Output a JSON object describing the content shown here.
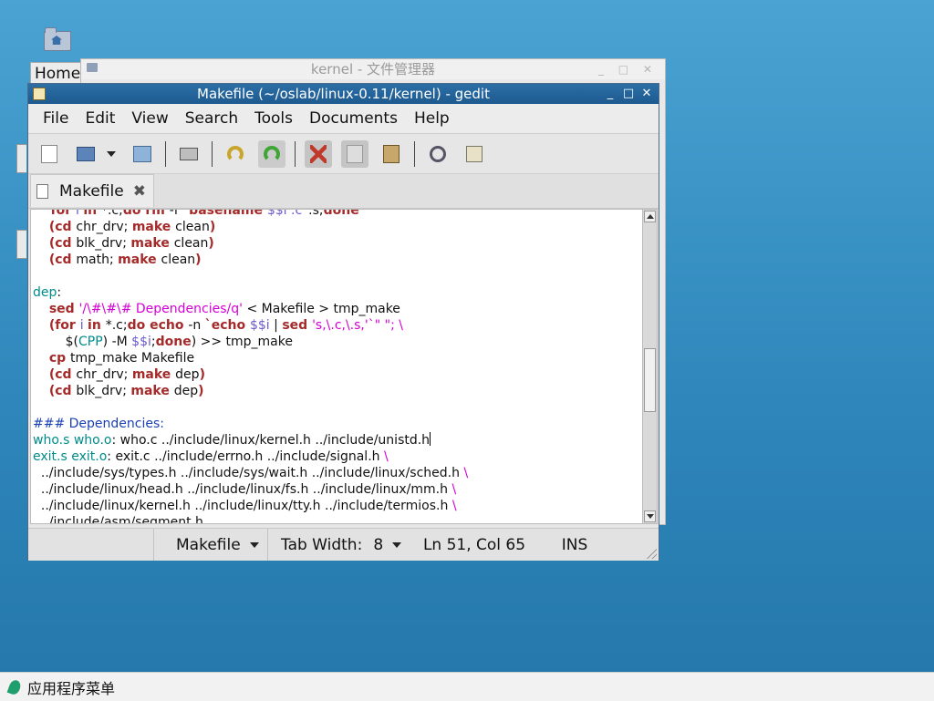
{
  "desktop": {
    "home_label": "Home"
  },
  "file_manager": {
    "title": "kernel - 文件管理器",
    "controls": "_ □ ✕"
  },
  "gedit": {
    "title": "Makefile (~/oslab/linux-0.11/kernel) - gedit",
    "window_controls": [
      "_",
      "□",
      "✕"
    ],
    "menu": [
      "File",
      "Edit",
      "View",
      "Search",
      "Tools",
      "Documents",
      "Help"
    ],
    "tab": {
      "name": "Makefile",
      "close": "✖"
    },
    "status": {
      "language": "Makefile",
      "tab_width_label": "Tab Width:",
      "tab_width_value": "8",
      "position": "Ln 51, Col 65",
      "mode": "INS"
    }
  },
  "code_lines": [
    [
      {
        "t": "\tfor ",
        "c": "kw"
      },
      {
        "t": "i ",
        "c": "var"
      },
      {
        "t": "in ",
        "c": "kw"
      },
      {
        "t": "*.c;"
      },
      {
        "t": "do rm ",
        "c": "kw"
      },
      {
        "t": "-f `"
      },
      {
        "t": "basename ",
        "c": "kw"
      },
      {
        "t": "$$i .c",
        "c": "var"
      },
      {
        "t": "`.s;"
      },
      {
        "t": "done",
        "c": "kw"
      }
    ],
    [
      {
        "t": "\t"
      },
      {
        "t": "(cd ",
        "c": "kw"
      },
      {
        "t": "chr_drv; "
      },
      {
        "t": "make ",
        "c": "kw"
      },
      {
        "t": "clean"
      },
      {
        "t": ")",
        "c": "kw"
      }
    ],
    [
      {
        "t": "\t"
      },
      {
        "t": "(cd ",
        "c": "kw"
      },
      {
        "t": "blk_drv; "
      },
      {
        "t": "make ",
        "c": "kw"
      },
      {
        "t": "clean"
      },
      {
        "t": ")",
        "c": "kw"
      }
    ],
    [
      {
        "t": "\t"
      },
      {
        "t": "(cd ",
        "c": "kw"
      },
      {
        "t": "math; "
      },
      {
        "t": "make ",
        "c": "kw"
      },
      {
        "t": "clean"
      },
      {
        "t": ")",
        "c": "kw"
      }
    ],
    [
      {
        "t": ""
      }
    ],
    [
      {
        "t": "dep",
        "c": "tg"
      },
      {
        "t": ":"
      }
    ],
    [
      {
        "t": "\t"
      },
      {
        "t": "sed ",
        "c": "kw"
      },
      {
        "t": "'/\\#\\#\\# Dependencies/q'",
        "c": "str"
      },
      {
        "t": " < Makefile > tmp_make"
      }
    ],
    [
      {
        "t": "\t"
      },
      {
        "t": "(for ",
        "c": "kw"
      },
      {
        "t": "i ",
        "c": "var"
      },
      {
        "t": "in ",
        "c": "kw"
      },
      {
        "t": "*.c;"
      },
      {
        "t": "do echo ",
        "c": "kw"
      },
      {
        "t": "-n "
      },
      {
        "t": "`echo ",
        "c": "kw"
      },
      {
        "t": "$$i",
        "c": "var"
      },
      {
        "t": " | "
      },
      {
        "t": "sed ",
        "c": "kw"
      },
      {
        "t": "'s,\\.c,\\.s,'`\" \"",
        "c": "str"
      },
      {
        "t": "; \\",
        "c": "str"
      }
    ],
    [
      {
        "t": "\t\t$("
      },
      {
        "t": "CPP",
        "c": "tg"
      },
      {
        "t": ") -M "
      },
      {
        "t": "$$i",
        "c": "var"
      },
      {
        "t": ";"
      },
      {
        "t": "done",
        "c": "kw"
      },
      {
        "t": ") >> tmp_make"
      }
    ],
    [
      {
        "t": "\t"
      },
      {
        "t": "cp ",
        "c": "kw"
      },
      {
        "t": "tmp_make Makefile"
      }
    ],
    [
      {
        "t": "\t"
      },
      {
        "t": "(cd ",
        "c": "kw"
      },
      {
        "t": "chr_drv; "
      },
      {
        "t": "make ",
        "c": "kw"
      },
      {
        "t": "dep"
      },
      {
        "t": ")",
        "c": "kw"
      }
    ],
    [
      {
        "t": "\t"
      },
      {
        "t": "(cd ",
        "c": "kw"
      },
      {
        "t": "blk_drv; "
      },
      {
        "t": "make ",
        "c": "kw"
      },
      {
        "t": "dep"
      },
      {
        "t": ")",
        "c": "kw"
      }
    ],
    [
      {
        "t": ""
      }
    ],
    [
      {
        "t": "### Dependencies:",
        "c": "cm"
      }
    ],
    [
      {
        "t": "who.s who.o",
        "c": "tg"
      },
      {
        "t": ": who.c ../include/linux/kernel.h ../include/unistd.h"
      },
      {
        "t": "",
        "c": "cursor"
      }
    ],
    [
      {
        "t": "exit.s exit.o",
        "c": "tg"
      },
      {
        "t": ": exit.c ../include/errno.h ../include/signal.h "
      },
      {
        "t": "\\",
        "c": "str"
      }
    ],
    [
      {
        "t": "  ../include/sys/types.h ../include/sys/wait.h ../include/linux/sched.h "
      },
      {
        "t": "\\",
        "c": "str"
      }
    ],
    [
      {
        "t": "  ../include/linux/head.h ../include/linux/fs.h ../include/linux/mm.h "
      },
      {
        "t": "\\",
        "c": "str"
      }
    ],
    [
      {
        "t": "  ../include/linux/kernel.h ../include/linux/tty.h ../include/termios.h "
      },
      {
        "t": "\\",
        "c": "str"
      }
    ],
    [
      {
        "t": "  ../include/asm/segment.h"
      }
    ]
  ],
  "taskbar": {
    "menu_label": "应用程序菜单"
  }
}
